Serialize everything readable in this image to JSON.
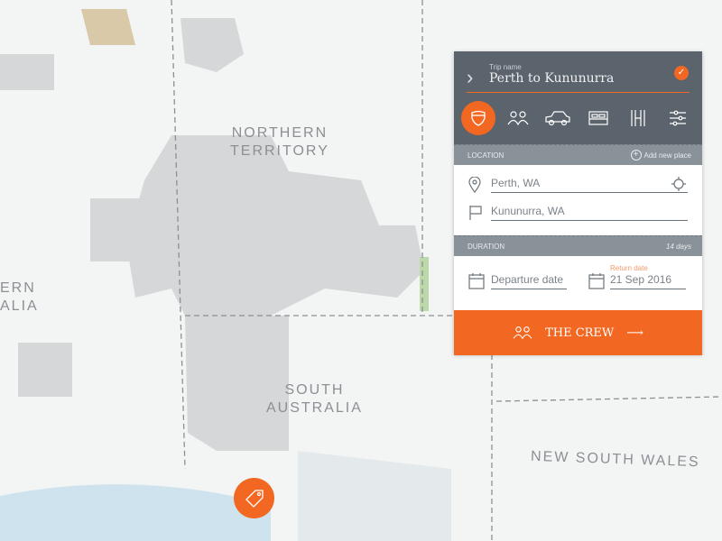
{
  "map": {
    "labels": [
      "NORTHERN\nTERRITORY",
      "SOUTH\nAUSTRALIA",
      "NEW SOUTH WALES",
      "ERN\nALIA"
    ]
  },
  "trip": {
    "name_label": "Trip name",
    "name": "Perth to Kununurra",
    "confirmed": true
  },
  "categories": [
    {
      "icon": "shield-icon",
      "active": true
    },
    {
      "icon": "people-icon"
    },
    {
      "icon": "car-icon"
    },
    {
      "icon": "bed-icon"
    },
    {
      "icon": "road-icon"
    },
    {
      "icon": "sliders-icon"
    }
  ],
  "location": {
    "label": "LOCATION",
    "add_label": "Add new place",
    "from": "Perth, WA",
    "to": "Kununurra, WA"
  },
  "duration": {
    "label": "DURATION",
    "days": "14 days",
    "departure_placeholder": "Departure date",
    "return_label": "Return date",
    "return_value": "21 Sep 2016"
  },
  "cta": {
    "label": "THE CREW"
  },
  "colors": {
    "accent": "#f26722",
    "header": "#5b646c",
    "bar": "#8a9299"
  }
}
